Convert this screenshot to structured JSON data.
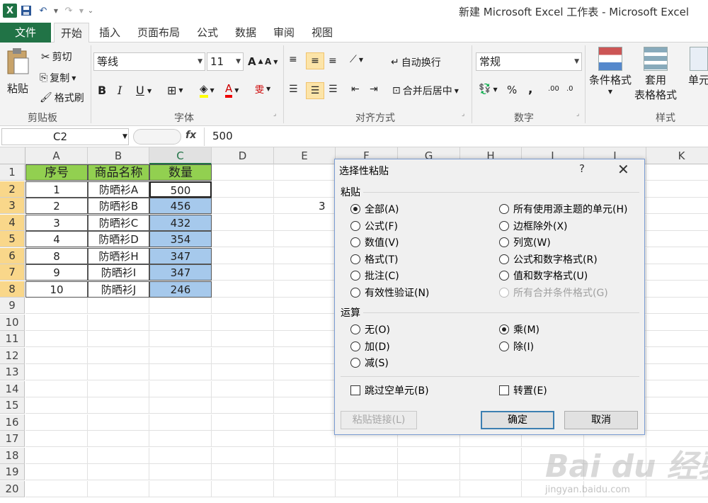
{
  "window": {
    "title": "新建 Microsoft Excel 工作表 - Microsoft Excel"
  },
  "tabs": [
    "文件",
    "开始",
    "插入",
    "页面布局",
    "公式",
    "数据",
    "审阅",
    "视图"
  ],
  "ribbon": {
    "clipboard": {
      "label": "剪贴板",
      "paste": "粘贴",
      "cut": "剪切",
      "copy": "复制",
      "format_painter": "格式刷"
    },
    "font": {
      "label": "字体",
      "font_name": "等线",
      "font_size": "11",
      "bold": "B",
      "italic": "I",
      "underline": "U"
    },
    "alignment": {
      "label": "对齐方式",
      "wrap": "自动换行",
      "merge": "合并后居中"
    },
    "number": {
      "label": "数字",
      "format": "常规",
      "percent": "%",
      "comma": ","
    },
    "styles": {
      "label": "样式",
      "conditional": "条件格式",
      "table_format_1": "套用",
      "table_format_2": "表格格式",
      "cell_styles": "单元"
    }
  },
  "formula_bar": {
    "name_box": "C2",
    "fx": "fx",
    "value": "500"
  },
  "grid": {
    "columns": [
      "A",
      "B",
      "C",
      "D",
      "E",
      "F",
      "G",
      "H",
      "I",
      "J",
      "K"
    ],
    "rows": [
      "1",
      "2",
      "3",
      "4",
      "5",
      "6",
      "7",
      "8",
      "9",
      "10",
      "11",
      "12",
      "13",
      "14",
      "15",
      "16",
      "17",
      "18",
      "19",
      "20"
    ],
    "headers": [
      "序号",
      "商品名称",
      "数量"
    ],
    "data": [
      [
        "1",
        "防晒衫A",
        "500"
      ],
      [
        "2",
        "防晒衫B",
        "456"
      ],
      [
        "3",
        "防晒衫C",
        "432"
      ],
      [
        "4",
        "防晒衫D",
        "354"
      ],
      [
        "8",
        "防晒衫H",
        "347"
      ],
      [
        "9",
        "防晒衫I",
        "347"
      ],
      [
        "10",
        "防晒衫J",
        "246"
      ]
    ],
    "e3_value": "3"
  },
  "dialog": {
    "title": "选择性粘贴",
    "help": "?",
    "close": "✕",
    "paste_section": "粘贴",
    "paste_left": [
      "全部(A)",
      "公式(F)",
      "数值(V)",
      "格式(T)",
      "批注(C)",
      "有效性验证(N)"
    ],
    "paste_right": [
      "所有使用源主题的单元(H)",
      "边框除外(X)",
      "列宽(W)",
      "公式和数字格式(R)",
      "值和数字格式(U)",
      "所有合并条件格式(G)"
    ],
    "operation_section": "运算",
    "op_left": [
      "无(O)",
      "加(D)",
      "减(S)"
    ],
    "op_right": [
      "乘(M)",
      "除(I)"
    ],
    "skip_blanks": "跳过空单元(B)",
    "transpose": "转置(E)",
    "paste_link": "粘贴链接(L)",
    "ok": "确定",
    "cancel": "取消"
  },
  "watermark": {
    "main": "Bai du 经验",
    "sub": "jingyan.baidu.com"
  }
}
